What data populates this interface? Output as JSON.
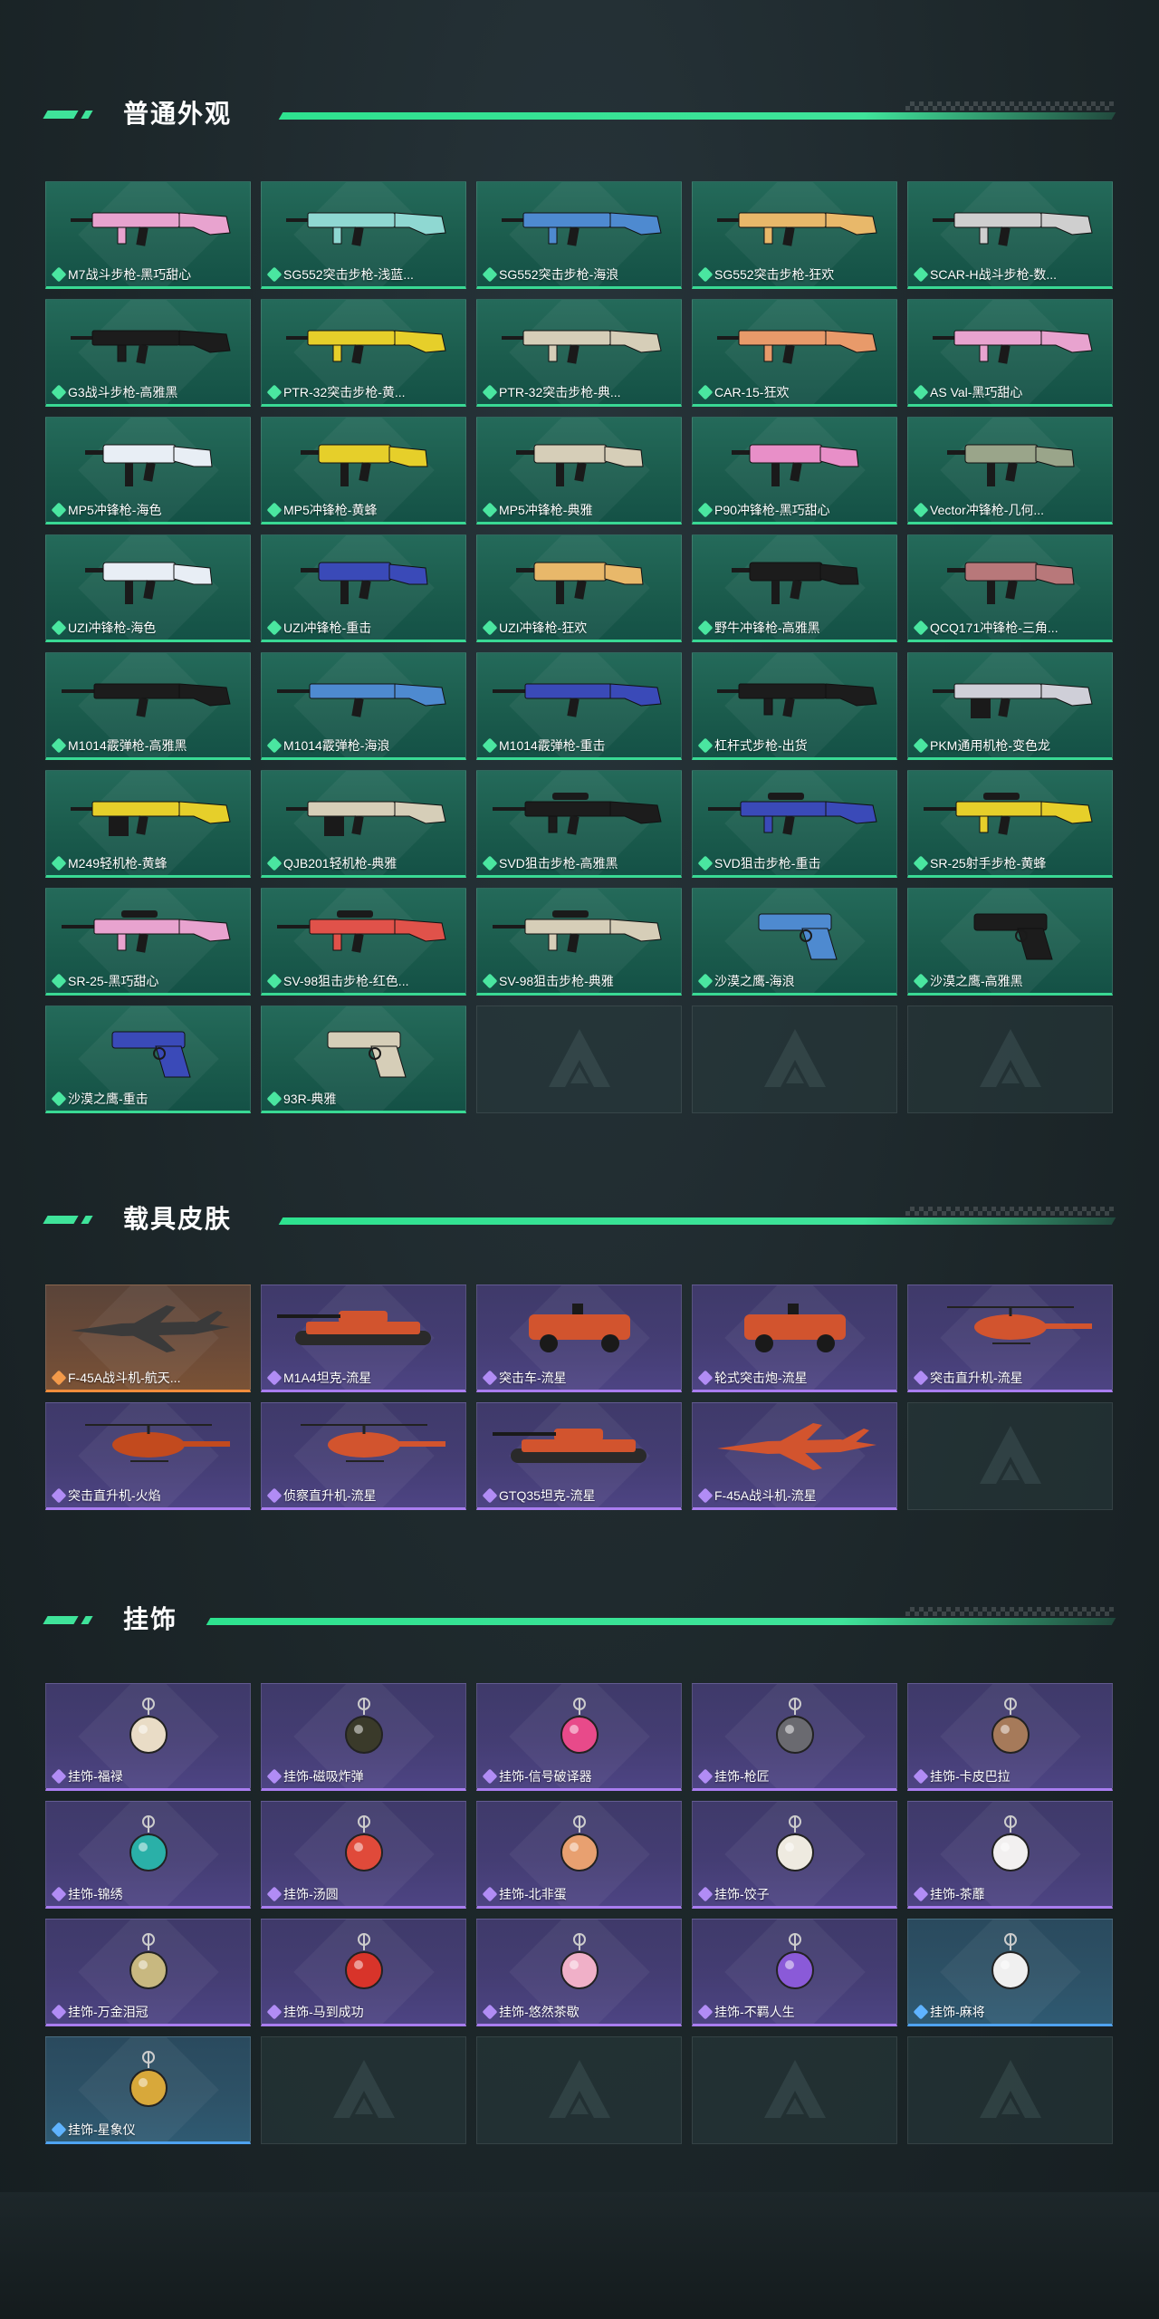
{
  "colors": {
    "accent_green": "#3fe39a",
    "rarity_green": "#4ae6a0",
    "rarity_purple": "#b18cf5",
    "rarity_orange": "#f39a4a",
    "rarity_blue": "#5fb3ff"
  },
  "sections": [
    {
      "title": "普通外观",
      "items": [
        {
          "label": "M7战斗步枪-黑巧甜心",
          "rarity": "green",
          "icon": "rifle-icon",
          "color": "#e8a3cf"
        },
        {
          "label": "SG552突击步枪-浅蓝...",
          "rarity": "green",
          "icon": "rifle-icon",
          "color": "#8fd8d2"
        },
        {
          "label": "SG552突击步枪-海浪",
          "rarity": "green",
          "icon": "rifle-icon",
          "color": "#4e8ad0"
        },
        {
          "label": "SG552突击步枪-狂欢",
          "rarity": "green",
          "icon": "rifle-icon",
          "color": "#e8b86a"
        },
        {
          "label": "SCAR-H战斗步枪-数...",
          "rarity": "green",
          "icon": "rifle-icon",
          "color": "#cfcfcf"
        },
        {
          "label": "G3战斗步枪-高雅黑",
          "rarity": "green",
          "icon": "rifle-icon",
          "color": "#1c1c1c"
        },
        {
          "label": "PTR-32突击步枪-黄...",
          "rarity": "green",
          "icon": "rifle-icon",
          "color": "#e6cf2a"
        },
        {
          "label": "PTR-32突击步枪-典...",
          "rarity": "green",
          "icon": "rifle-icon",
          "color": "#d6ceb8"
        },
        {
          "label": "CAR-15-狂欢",
          "rarity": "green",
          "icon": "rifle-icon",
          "color": "#e89a6a"
        },
        {
          "label": "AS Val-黑巧甜心",
          "rarity": "green",
          "icon": "rifle-icon",
          "color": "#e8a3cf"
        },
        {
          "label": "MP5冲锋枪-海色",
          "rarity": "green",
          "icon": "smg-icon",
          "color": "#e8eef5"
        },
        {
          "label": "MP5冲锋枪-黄蜂",
          "rarity": "green",
          "icon": "smg-icon",
          "color": "#e6cf2a"
        },
        {
          "label": "MP5冲锋枪-典雅",
          "rarity": "green",
          "icon": "smg-icon",
          "color": "#d6ceb8"
        },
        {
          "label": "P90冲锋枪-黑巧甜心",
          "rarity": "green",
          "icon": "smg-icon",
          "color": "#e88fc8"
        },
        {
          "label": "Vector冲锋枪-几何...",
          "rarity": "green",
          "icon": "smg-icon",
          "color": "#9aa58a"
        },
        {
          "label": "UZI冲锋枪-海色",
          "rarity": "green",
          "icon": "smg-icon",
          "color": "#e8eef5"
        },
        {
          "label": "UZI冲锋枪-重击",
          "rarity": "green",
          "icon": "smg-icon",
          "color": "#3a4ab8"
        },
        {
          "label": "UZI冲锋枪-狂欢",
          "rarity": "green",
          "icon": "smg-icon",
          "color": "#e8b86a"
        },
        {
          "label": "野牛冲锋枪-高雅黑",
          "rarity": "green",
          "icon": "smg-icon",
          "color": "#1c1c1c"
        },
        {
          "label": "QCQ171冲锋枪-三角...",
          "rarity": "green",
          "icon": "smg-icon",
          "color": "#b8787a"
        },
        {
          "label": "M1014霰弹枪-高雅黑",
          "rarity": "green",
          "icon": "shotgun-icon",
          "color": "#1c1c1c"
        },
        {
          "label": "M1014霰弹枪-海浪",
          "rarity": "green",
          "icon": "shotgun-icon",
          "color": "#4e8ad0"
        },
        {
          "label": "M1014霰弹枪-重击",
          "rarity": "green",
          "icon": "shotgun-icon",
          "color": "#3a4ab8"
        },
        {
          "label": "杠杆式步枪-出货",
          "rarity": "green",
          "icon": "rifle-icon",
          "color": "#1c1c1c"
        },
        {
          "label": "PKM通用机枪-变色龙",
          "rarity": "green",
          "icon": "machine-gun-icon",
          "color": "#cfcfd8"
        },
        {
          "label": "M249轻机枪-黄蜂",
          "rarity": "green",
          "icon": "machine-gun-icon",
          "color": "#e6cf2a"
        },
        {
          "label": "QJB201轻机枪-典雅",
          "rarity": "green",
          "icon": "machine-gun-icon",
          "color": "#d6ceb8"
        },
        {
          "label": "SVD狙击步枪-高雅黑",
          "rarity": "green",
          "icon": "sniper-icon",
          "color": "#1c1c1c"
        },
        {
          "label": "SVD狙击步枪-重击",
          "rarity": "green",
          "icon": "sniper-icon",
          "color": "#3a4ab8"
        },
        {
          "label": "SR-25射手步枪-黄蜂",
          "rarity": "green",
          "icon": "sniper-icon",
          "color": "#e6cf2a"
        },
        {
          "label": "SR-25-黑巧甜心",
          "rarity": "green",
          "icon": "sniper-icon",
          "color": "#e8a3cf"
        },
        {
          "label": "SV-98狙击步枪-红色...",
          "rarity": "green",
          "icon": "sniper-icon",
          "color": "#e0524a"
        },
        {
          "label": "SV-98狙击步枪-典雅",
          "rarity": "green",
          "icon": "sniper-icon",
          "color": "#d6ceb8"
        },
        {
          "label": "沙漠之鹰-海浪",
          "rarity": "green",
          "icon": "pistol-icon",
          "color": "#4e8ad0"
        },
        {
          "label": "沙漠之鹰-高雅黑",
          "rarity": "green",
          "icon": "pistol-icon",
          "color": "#1c1c1c"
        },
        {
          "label": "沙漠之鹰-重击",
          "rarity": "green",
          "icon": "pistol-icon",
          "color": "#3a4ab8"
        },
        {
          "label": "93R-典雅",
          "rarity": "green",
          "icon": "pistol-icon",
          "color": "#d6ceb8"
        }
      ],
      "empty_slots": 3
    },
    {
      "title": "载具皮肤",
      "items": [
        {
          "label": "F-45A战斗机-航天...",
          "rarity": "orange",
          "icon": "fighter-jet-icon",
          "color": "#3a3a3a"
        },
        {
          "label": "M1A4坦克-流星",
          "rarity": "purple",
          "icon": "tank-icon",
          "color": "#d2542e"
        },
        {
          "label": "突击车-流星",
          "rarity": "purple",
          "icon": "armored-car-icon",
          "color": "#d2542e"
        },
        {
          "label": "轮式突击炮-流星",
          "rarity": "purple",
          "icon": "armored-car-icon",
          "color": "#d2542e"
        },
        {
          "label": "突击直升机-流星",
          "rarity": "purple",
          "icon": "helicopter-icon",
          "color": "#d2542e"
        },
        {
          "label": "突击直升机-火焰",
          "rarity": "purple",
          "icon": "helicopter-icon",
          "color": "#c24a1e"
        },
        {
          "label": "侦察直升机-流星",
          "rarity": "purple",
          "icon": "helicopter-icon",
          "color": "#d2542e"
        },
        {
          "label": "GTQ35坦克-流星",
          "rarity": "purple",
          "icon": "tank-icon",
          "color": "#d2542e"
        },
        {
          "label": "F-45A战斗机-流星",
          "rarity": "purple",
          "icon": "fighter-jet-icon",
          "color": "#d2542e"
        }
      ],
      "empty_slots": 1
    },
    {
      "title": "挂饰",
      "items": [
        {
          "label": "挂饰-福禄",
          "rarity": "purple",
          "icon": "charm-icon",
          "color": "#e9dcc6"
        },
        {
          "label": "挂饰-磁吸炸弹",
          "rarity": "purple",
          "icon": "charm-icon",
          "color": "#3a3a2a"
        },
        {
          "label": "挂饰-信号破译器",
          "rarity": "purple",
          "icon": "charm-icon",
          "color": "#e84a8a"
        },
        {
          "label": "挂饰-枪匠",
          "rarity": "purple",
          "icon": "charm-icon",
          "color": "#6a6a70"
        },
        {
          "label": "挂饰-卡皮巴拉",
          "rarity": "purple",
          "icon": "charm-icon",
          "color": "#a67a5a"
        },
        {
          "label": "挂饰-锦绣",
          "rarity": "purple",
          "icon": "charm-icon",
          "color": "#2ab0a8"
        },
        {
          "label": "挂饰-汤圆",
          "rarity": "purple",
          "icon": "charm-icon",
          "color": "#e04a3a"
        },
        {
          "label": "挂饰-北非蛋",
          "rarity": "purple",
          "icon": "charm-icon",
          "color": "#e8a070"
        },
        {
          "label": "挂饰-饺子",
          "rarity": "purple",
          "icon": "charm-icon",
          "color": "#eeeae0"
        },
        {
          "label": "挂饰-茶蘼",
          "rarity": "purple",
          "icon": "charm-icon",
          "color": "#f2f0f0"
        },
        {
          "label": "挂饰-万金泪冠",
          "rarity": "purple",
          "icon": "charm-icon",
          "color": "#c8b880"
        },
        {
          "label": "挂饰-马到成功",
          "rarity": "purple",
          "icon": "charm-icon",
          "color": "#d8342a"
        },
        {
          "label": "挂饰-悠然茶歇",
          "rarity": "purple",
          "icon": "charm-icon",
          "color": "#f0b0c8"
        },
        {
          "label": "挂饰-不羁人生",
          "rarity": "purple",
          "icon": "charm-icon",
          "color": "#8a5ad8"
        },
        {
          "label": "挂饰-麻将",
          "rarity": "blue",
          "icon": "charm-icon",
          "color": "#f0f0f0"
        },
        {
          "label": "挂饰-星象仪",
          "rarity": "blue",
          "icon": "charm-icon",
          "color": "#d8a83a"
        }
      ],
      "empty_slots": 4
    }
  ]
}
